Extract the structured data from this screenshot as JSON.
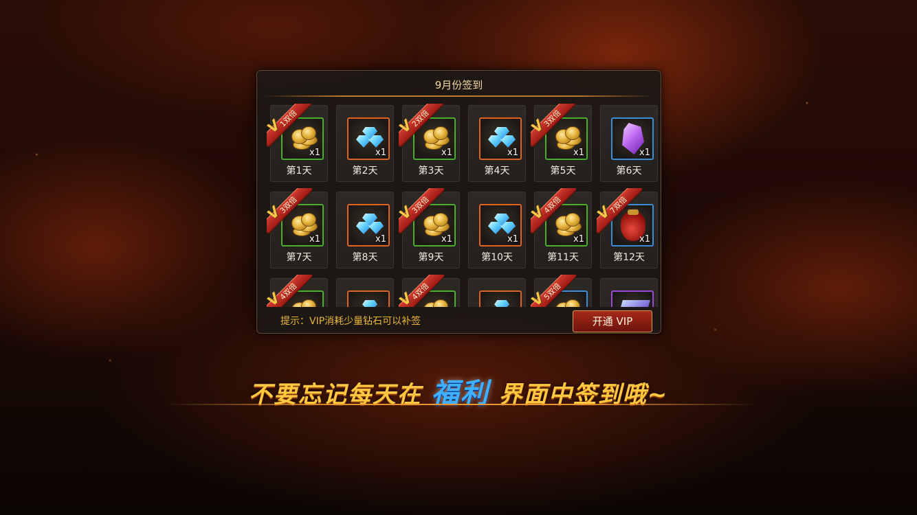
{
  "panel": {
    "title": "9月份签到",
    "hint": "提示：VIP消耗少量钻石可以补签",
    "vip_button": "开通  VIP"
  },
  "days": [
    {
      "label": "第1天",
      "item": "gold-coins",
      "qty": "x1",
      "border": "green",
      "ribbon": {
        "v": "V",
        "text": "1双倍"
      }
    },
    {
      "label": "第2天",
      "item": "blue-diamonds",
      "qty": "x1",
      "border": "orange",
      "ribbon": null
    },
    {
      "label": "第3天",
      "item": "gold-coins",
      "qty": "x1",
      "border": "green",
      "ribbon": {
        "v": "V",
        "text": "2双倍"
      }
    },
    {
      "label": "第4天",
      "item": "blue-diamonds",
      "qty": "x1",
      "border": "orange",
      "ribbon": null
    },
    {
      "label": "第5天",
      "item": "gold-coins",
      "qty": "x1",
      "border": "green",
      "ribbon": {
        "v": "V",
        "text": "3双倍"
      }
    },
    {
      "label": "第6天",
      "item": "purple-crystal",
      "qty": "x1",
      "border": "blue",
      "ribbon": null
    },
    {
      "label": "第7天",
      "item": "gold-coins",
      "qty": "x1",
      "border": "green",
      "ribbon": {
        "v": "V",
        "text": "3双倍"
      }
    },
    {
      "label": "第8天",
      "item": "blue-diamonds",
      "qty": "x1",
      "border": "orange",
      "ribbon": null
    },
    {
      "label": "第9天",
      "item": "gold-coins",
      "qty": "x1",
      "border": "green",
      "ribbon": {
        "v": "V",
        "text": "3双倍"
      }
    },
    {
      "label": "第10天",
      "item": "blue-diamonds",
      "qty": "x1",
      "border": "orange",
      "ribbon": null
    },
    {
      "label": "第11天",
      "item": "gold-coins",
      "qty": "x1",
      "border": "green",
      "ribbon": {
        "v": "V",
        "text": "4双倍"
      }
    },
    {
      "label": "第12天",
      "item": "red-pouch",
      "qty": "x1",
      "border": "blue",
      "ribbon": {
        "v": "V",
        "text": "7双倍"
      }
    },
    {
      "label": "",
      "item": "gold-coins",
      "qty": "",
      "border": "green",
      "ribbon": {
        "v": "V",
        "text": "4双倍"
      }
    },
    {
      "label": "",
      "item": "blue-diamonds",
      "qty": "",
      "border": "orange",
      "ribbon": null
    },
    {
      "label": "",
      "item": "gold-coins",
      "qty": "",
      "border": "green",
      "ribbon": {
        "v": "V",
        "text": "4双倍"
      }
    },
    {
      "label": "",
      "item": "blue-diamonds",
      "qty": "",
      "border": "orange",
      "ribbon": null
    },
    {
      "label": "",
      "item": "gold-coins",
      "qty": "",
      "border": "blue",
      "ribbon": {
        "v": "V",
        "text": "5双倍"
      }
    },
    {
      "label": "",
      "item": "blue-scroll",
      "qty": "",
      "border": "purple",
      "ribbon": null
    }
  ],
  "banner": {
    "part1": "不要忘记每天在",
    "highlight": "福利",
    "part2": "界面中签到哦~"
  },
  "colors": {
    "accent_gold": "#ffc840",
    "accent_blue": "#3fb0ff",
    "hint_text": "#e9b83a",
    "vip_button_bg": "#8a1e12"
  }
}
